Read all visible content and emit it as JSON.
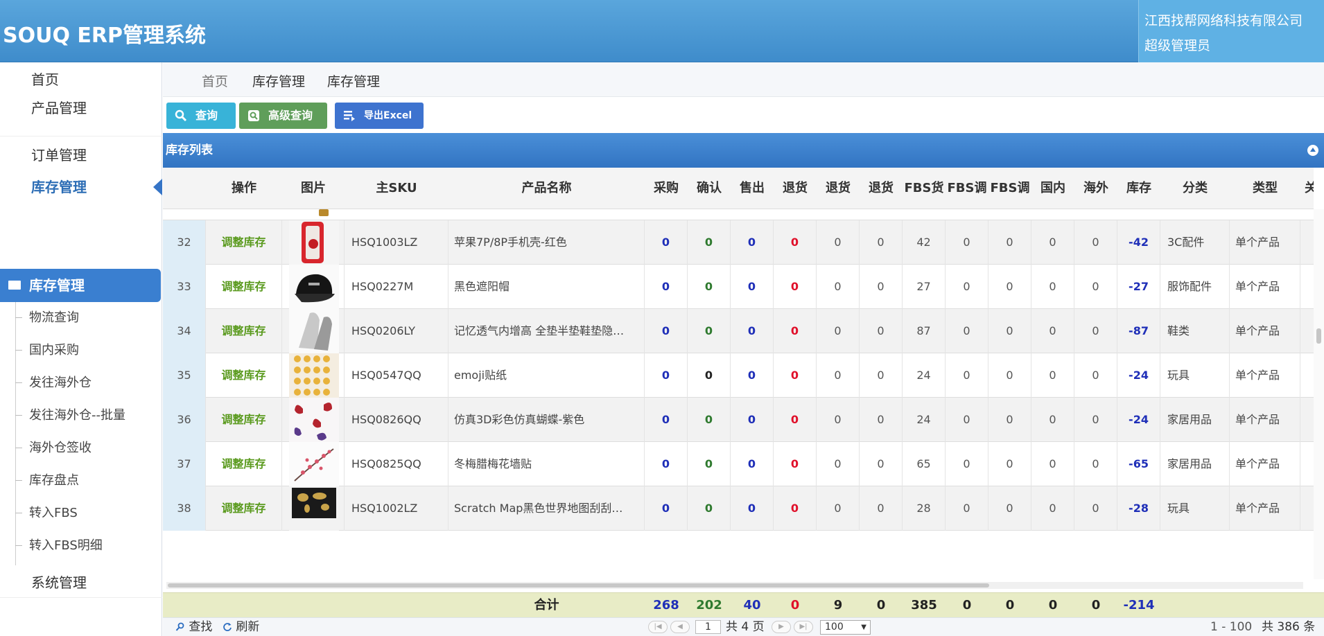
{
  "header": {
    "app_title": "SOUQ ERP管理系统",
    "company": "江西找帮网络科技有限公司",
    "role": "超级管理员"
  },
  "sidebar": {
    "top_items": [
      {
        "label": "首页"
      },
      {
        "label": "产品管理"
      },
      {
        "label": "订单管理"
      },
      {
        "label": "库存管理"
      }
    ],
    "section": "库存管理",
    "sub_items": [
      {
        "label": "物流查询"
      },
      {
        "label": "国内采购"
      },
      {
        "label": "发往海外仓"
      },
      {
        "label": "发往海外仓--批量"
      },
      {
        "label": "海外仓签收"
      },
      {
        "label": "库存盘点"
      },
      {
        "label": "转入FBS"
      },
      {
        "label": "转入FBS明细"
      }
    ],
    "bottom_item": "系统管理"
  },
  "breadcrumb": [
    "首页",
    "库存管理",
    "库存管理"
  ],
  "toolbar": {
    "search": "查询",
    "advanced": "高级查询",
    "export": "导出Excel"
  },
  "panel_title": "库存列表",
  "columns": [
    "操作",
    "图片",
    "主SKU",
    "产品名称",
    "采购",
    "确认",
    "售出",
    "退货",
    "退货",
    "退货",
    "FBS货",
    "FBS调",
    "FBS调",
    "国内",
    "海外",
    "库存",
    "分类",
    "类型",
    "关"
  ],
  "rows": [
    {
      "no": "32",
      "op": "调整库存",
      "sku": "HSQ1003LZ",
      "name": "苹果7P/8P手机壳-红色",
      "cg": "0",
      "qr": "0",
      "sc": "0",
      "th1": "0",
      "th2": "0",
      "th3": "0",
      "fbs1": "42",
      "fbs2": "0",
      "fbs3": "0",
      "gn": "0",
      "hw": "0",
      "kc": "-42",
      "fl": "3C配件",
      "lx": "单个产品",
      "qr_color": "green",
      "img": "phonecase"
    },
    {
      "no": "33",
      "op": "调整库存",
      "sku": "HSQ0227M",
      "name": "黑色遮阳帽",
      "cg": "0",
      "qr": "0",
      "sc": "0",
      "th1": "0",
      "th2": "0",
      "th3": "0",
      "fbs1": "27",
      "fbs2": "0",
      "fbs3": "0",
      "gn": "0",
      "hw": "0",
      "kc": "-27",
      "fl": "服饰配件",
      "lx": "单个产品",
      "qr_color": "green",
      "img": "cap"
    },
    {
      "no": "34",
      "op": "调整库存",
      "sku": "HSQ0206LY",
      "name": "记忆透气内增高 全垫半垫鞋垫隐…",
      "cg": "0",
      "qr": "0",
      "sc": "0",
      "th1": "0",
      "th2": "0",
      "th3": "0",
      "fbs1": "87",
      "fbs2": "0",
      "fbs3": "0",
      "gn": "0",
      "hw": "0",
      "kc": "-87",
      "fl": "鞋类",
      "lx": "单个产品",
      "qr_color": "green",
      "img": "insole"
    },
    {
      "no": "35",
      "op": "调整库存",
      "sku": "HSQ0547QQ",
      "name": "emoji贴纸",
      "cg": "0",
      "qr": "0",
      "sc": "0",
      "th1": "0",
      "th2": "0",
      "th3": "0",
      "fbs1": "24",
      "fbs2": "0",
      "fbs3": "0",
      "gn": "0",
      "hw": "0",
      "kc": "-24",
      "fl": "玩具",
      "lx": "单个产品",
      "qr_color": "dark",
      "img": "emoji"
    },
    {
      "no": "36",
      "op": "调整库存",
      "sku": "HSQ0826QQ",
      "name": "仿真3D彩色仿真蝴蝶-紫色",
      "cg": "0",
      "qr": "0",
      "sc": "0",
      "th1": "0",
      "th2": "0",
      "th3": "0",
      "fbs1": "24",
      "fbs2": "0",
      "fbs3": "0",
      "gn": "0",
      "hw": "0",
      "kc": "-24",
      "fl": "家居用品",
      "lx": "单个产品",
      "qr_color": "green",
      "img": "butterfly"
    },
    {
      "no": "37",
      "op": "调整库存",
      "sku": "HSQ0825QQ",
      "name": "冬梅腊梅花墙贴",
      "cg": "0",
      "qr": "0",
      "sc": "0",
      "th1": "0",
      "th2": "0",
      "th3": "0",
      "fbs1": "65",
      "fbs2": "0",
      "fbs3": "0",
      "gn": "0",
      "hw": "0",
      "kc": "-65",
      "fl": "家居用品",
      "lx": "单个产品",
      "qr_color": "green",
      "img": "plum"
    },
    {
      "no": "38",
      "op": "调整库存",
      "sku": "HSQ1002LZ",
      "name": "Scratch Map黑色世界地图刮刮…",
      "cg": "0",
      "qr": "0",
      "sc": "0",
      "th1": "0",
      "th2": "0",
      "th3": "0",
      "fbs1": "28",
      "fbs2": "0",
      "fbs3": "0",
      "gn": "0",
      "hw": "0",
      "kc": "-28",
      "fl": "玩具",
      "lx": "单个产品",
      "qr_color": "green",
      "img": "map"
    }
  ],
  "totals": {
    "label": "合计",
    "cg": "268",
    "qr": "202",
    "sc": "40",
    "th1": "0",
    "th2": "9",
    "th3": "0",
    "fbs1": "385",
    "fbs2": "0",
    "fbs3": "0",
    "gn": "0",
    "hw": "0",
    "kc": "-214"
  },
  "pager": {
    "find": "查找",
    "refresh": "刷新",
    "page_value": "1",
    "total_pages": "共 4 页",
    "page_size": "100",
    "range": "1 - 100",
    "total_count": "共 386 条"
  },
  "colors": {
    "header": "#3f8ccb",
    "accent": "#3a7fd0",
    "op_link": "#5a9a1e",
    "negative_stock": "#1f2fb8",
    "returns": "#e0102a"
  }
}
